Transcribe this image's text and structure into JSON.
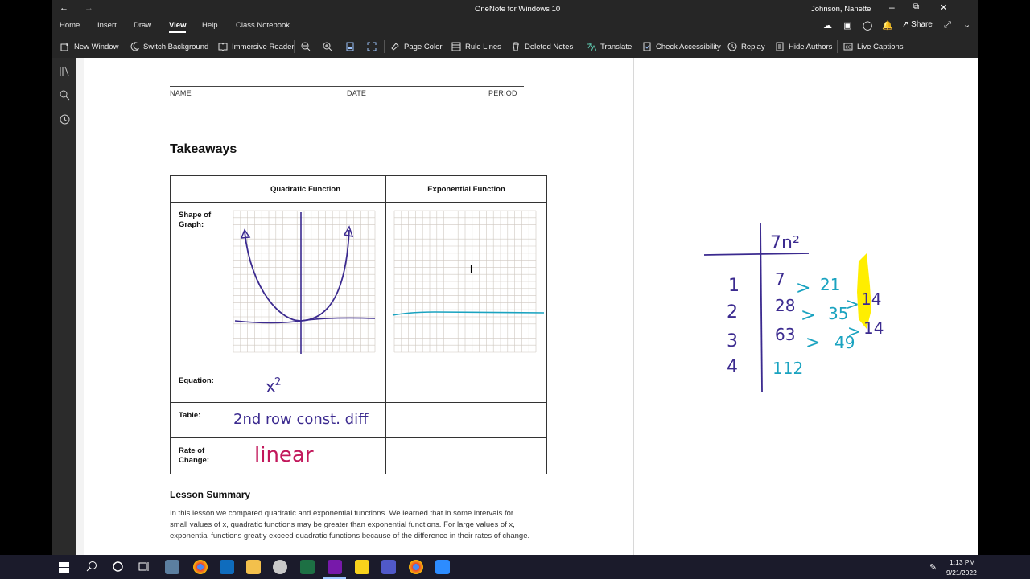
{
  "window": {
    "title": "OneNote for Windows 10",
    "user": "Johnson, Nanette",
    "share_label": "Share"
  },
  "ribbon": {
    "tabs": [
      "Home",
      "Insert",
      "Draw",
      "View",
      "Help",
      "Class Notebook"
    ],
    "active_tab": "View",
    "view_tools": [
      {
        "label": "New Window",
        "icon": "new-window-icon"
      },
      {
        "label": "Switch Background",
        "icon": "moon-icon"
      },
      {
        "label": "Immersive Reader",
        "icon": "immersive-reader-icon"
      },
      {
        "label": "",
        "icon": "zoom-out-icon"
      },
      {
        "label": "",
        "icon": "zoom-in-icon"
      },
      {
        "label": "",
        "icon": "page-width-icon"
      },
      {
        "label": "",
        "icon": "fit-page-icon"
      },
      {
        "label": "Page Color",
        "icon": "page-color-icon"
      },
      {
        "label": "Rule Lines",
        "icon": "rule-lines-icon"
      },
      {
        "label": "Deleted Notes",
        "icon": "trash-icon"
      },
      {
        "label": "Translate",
        "icon": "translate-icon"
      },
      {
        "label": "Check Accessibility",
        "icon": "accessibility-icon"
      },
      {
        "label": "Replay",
        "icon": "replay-icon"
      },
      {
        "label": "Hide Authors",
        "icon": "hide-authors-icon"
      },
      {
        "label": "Live Captions",
        "icon": "captions-icon"
      }
    ]
  },
  "worksheet": {
    "header_fields": [
      "NAME",
      "DATE",
      "PERIOD"
    ],
    "heading": "Takeaways",
    "columns": [
      "Quadratic Function",
      "Exponential Function"
    ],
    "rows": [
      "Shape of Graph:",
      "Equation:",
      "Table:",
      "Rate of Change:"
    ],
    "handwriting": {
      "equation_base": "x",
      "equation_exp": "2",
      "table_note": "2nd row const. diff",
      "rate_note": "linear"
    },
    "lesson_summary_title": "Lesson Summary",
    "lesson_summary_text": "In this lesson we compared quadratic and exponential functions. We learned that in some intervals for small values of x, quadratic functions may be greater than exponential functions. For large values of x, exponential functions greatly exceed quadratic functions because of the difference in their rates of change."
  },
  "ink_table": {
    "header": "7n²",
    "n_values": [
      "1",
      "2",
      "3",
      "4"
    ],
    "values": [
      "7",
      "28",
      "63",
      "112"
    ],
    "first_differences": [
      "21",
      "35",
      "49"
    ],
    "second_differences": [
      "14",
      "14"
    ]
  },
  "taskbar": {
    "time": "1:13 PM",
    "date": "9/21/2022"
  },
  "colors": {
    "ink_purple": "#3b2a8f",
    "ink_teal": "#1aa3c0",
    "ink_magenta": "#c2185b",
    "highlight_yellow": "#ffee00",
    "ribbon_bg": "#262626"
  }
}
